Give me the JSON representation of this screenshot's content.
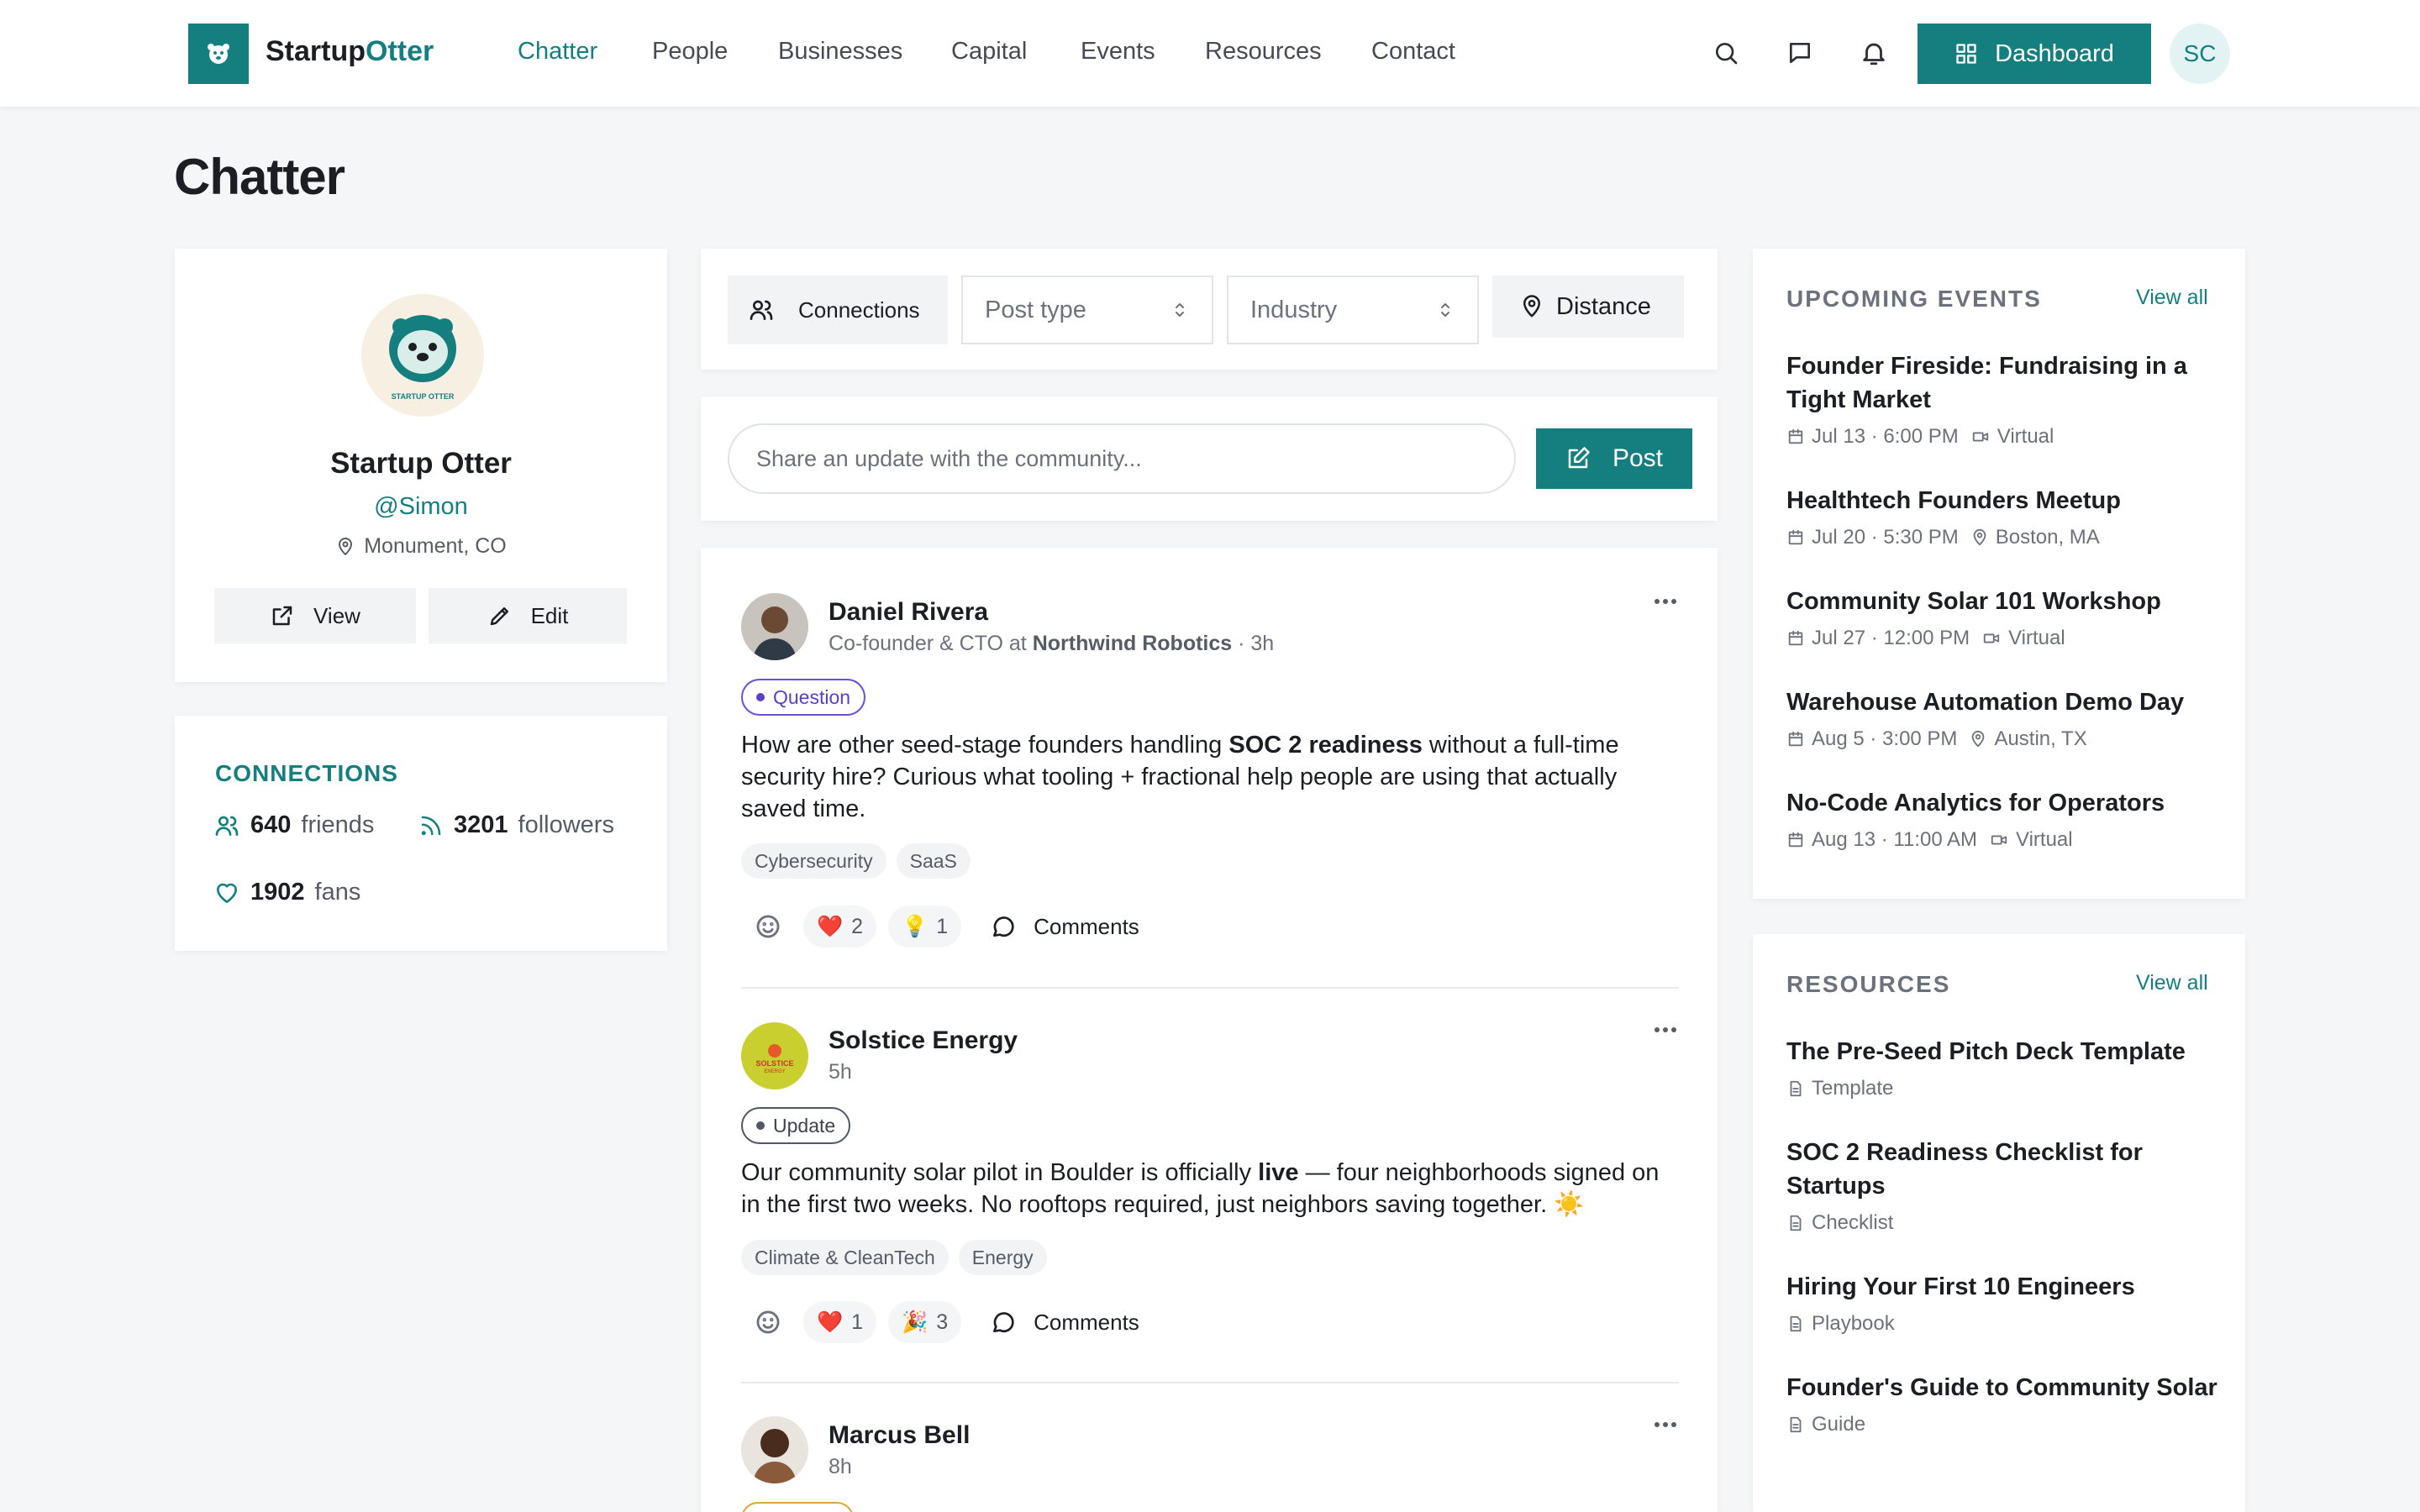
{
  "nav": {
    "brand_a": "Startup",
    "brand_b": "Otter",
    "links": [
      "Chatter",
      "People",
      "Businesses",
      "Capital",
      "Events",
      "Resources",
      "Contact"
    ],
    "dashboard_label": "Dashboard",
    "avatar_initials": "SC",
    "accent": "#157f80"
  },
  "page": {
    "title": "Chatter"
  },
  "profile": {
    "logo_text": "STARTUP OTTER",
    "name": "Startup Otter",
    "handle": "@Simon",
    "location": "Monument, CO",
    "view_label": "View",
    "edit_label": "Edit"
  },
  "connections": {
    "title": "CONNECTIONS",
    "friends_count": "640",
    "friends_label": "friends",
    "followers_count": "3201",
    "followers_label": "followers",
    "fans_count": "1902",
    "fans_label": "fans"
  },
  "filters": {
    "connections_label": "Connections",
    "post_type_placeholder": "Post type",
    "industry_placeholder": "Industry",
    "distance_label": "Distance"
  },
  "composer": {
    "placeholder": "Share an update with the community...",
    "post_label": "Post"
  },
  "posts": [
    {
      "author": "Daniel Rivera",
      "role": "Co-founder & CTO at ",
      "company": "Northwind Robotics",
      "time": " · 3h",
      "badge": "Question",
      "body_1": "How are other seed-stage founders handling ",
      "body_bold": "SOC 2 readiness",
      "body_2": " without a full-time security hire? Curious what tooling + fractional help people are using that actually saved time.",
      "tags": [
        "Cybersecurity",
        "SaaS"
      ],
      "reactions": [
        {
          "emoji": "❤️",
          "count": "2"
        },
        {
          "emoji": "💡",
          "count": "1"
        }
      ],
      "comments_label": "Comments"
    },
    {
      "author": "Solstice Energy",
      "logo_text": "SOLSTICE ENERGY",
      "time": "5h",
      "badge": "Update",
      "body_1": "Our community solar pilot in Boulder is officially ",
      "body_bold": "live",
      "body_2": " — four neighborhoods signed on in the first two weeks. No rooftops required, just neighbors saving together. ☀️",
      "tags": [
        "Climate & CleanTech",
        "Energy"
      ],
      "reactions": [
        {
          "emoji": "❤️",
          "count": "1"
        },
        {
          "emoji": "🎉",
          "count": "3"
        }
      ],
      "comments_label": "Comments"
    },
    {
      "author": "Marcus Bell",
      "time": "8h"
    }
  ],
  "events": {
    "title": "UPCOMING EVENTS",
    "view_all": "View all",
    "items": [
      {
        "title": "Founder Fireside: Fundraising in a Tight Market",
        "date": "Jul 13 · 6:00 PM",
        "place": "Virtual",
        "place_icon": "video-icon"
      },
      {
        "title": "Healthtech Founders Meetup",
        "date": "Jul 20 · 5:30 PM",
        "place": "Boston, MA",
        "place_icon": "location-pin-icon"
      },
      {
        "title": "Community Solar 101 Workshop",
        "date": "Jul 27 · 12:00 PM",
        "place": "Virtual",
        "place_icon": "video-icon"
      },
      {
        "title": "Warehouse Automation Demo Day",
        "date": "Aug 5 · 3:00 PM",
        "place": "Austin, TX",
        "place_icon": "location-pin-icon"
      },
      {
        "title": "No-Code Analytics for Operators",
        "date": "Aug 13 · 11:00 AM",
        "place": "Virtual",
        "place_icon": "video-icon"
      }
    ]
  },
  "resources": {
    "title": "RESOURCES",
    "view_all": "View all",
    "items": [
      {
        "title": "The Pre-Seed Pitch Deck Template",
        "type": "Template"
      },
      {
        "title": "SOC 2 Readiness Checklist for Startups",
        "type": "Checklist"
      },
      {
        "title": "Hiring Your First 10 Engineers",
        "type": "Playbook"
      },
      {
        "title": "Founder's Guide to Community Solar",
        "type": "Guide"
      }
    ]
  }
}
